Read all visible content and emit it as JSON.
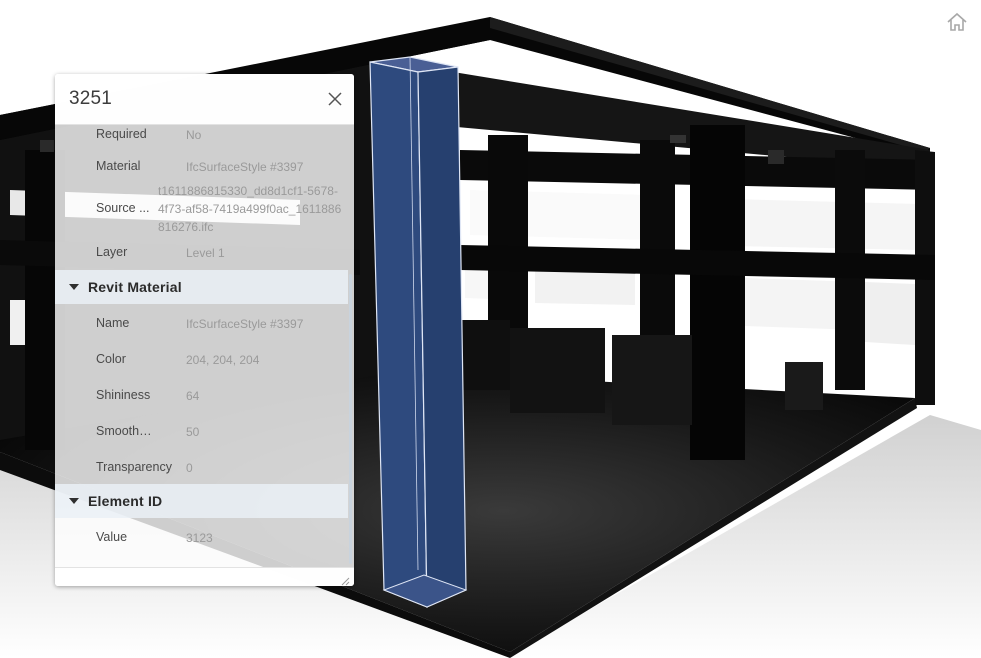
{
  "viewer": {
    "home_icon": "home-icon"
  },
  "panel": {
    "title": "3251",
    "close_icon": "close-icon",
    "rows_top": [
      {
        "label": "Required",
        "value": "No"
      },
      {
        "label": "Material",
        "value": "IfcSurfaceStyle #3397"
      },
      {
        "label": "Source ...",
        "value": "t1611886815330_dd8d1cf1-5678-4f73-af58-7419a499f0ac_1611886816276.ifc"
      },
      {
        "label": "Layer",
        "value": "Level 1"
      }
    ],
    "categories": [
      {
        "label": "Revit Material",
        "rows": [
          {
            "label": "Name",
            "value": "IfcSurfaceStyle #3397"
          },
          {
            "label": "Color",
            "value": "204, 204, 204"
          },
          {
            "label": "Shininess",
            "value": "64"
          },
          {
            "label": "Smoothness",
            "value": "50"
          },
          {
            "label": "Transparency",
            "value": "0"
          }
        ]
      },
      {
        "label": "Element ID",
        "rows": [
          {
            "label": "Value",
            "value": "3123"
          }
        ]
      }
    ],
    "resize_icon": "resize-grip-icon"
  },
  "colors": {
    "selection_fill": "#2e4a7e",
    "model_dark": "#0a0a0a",
    "category_bg": "#eaf0f6"
  }
}
